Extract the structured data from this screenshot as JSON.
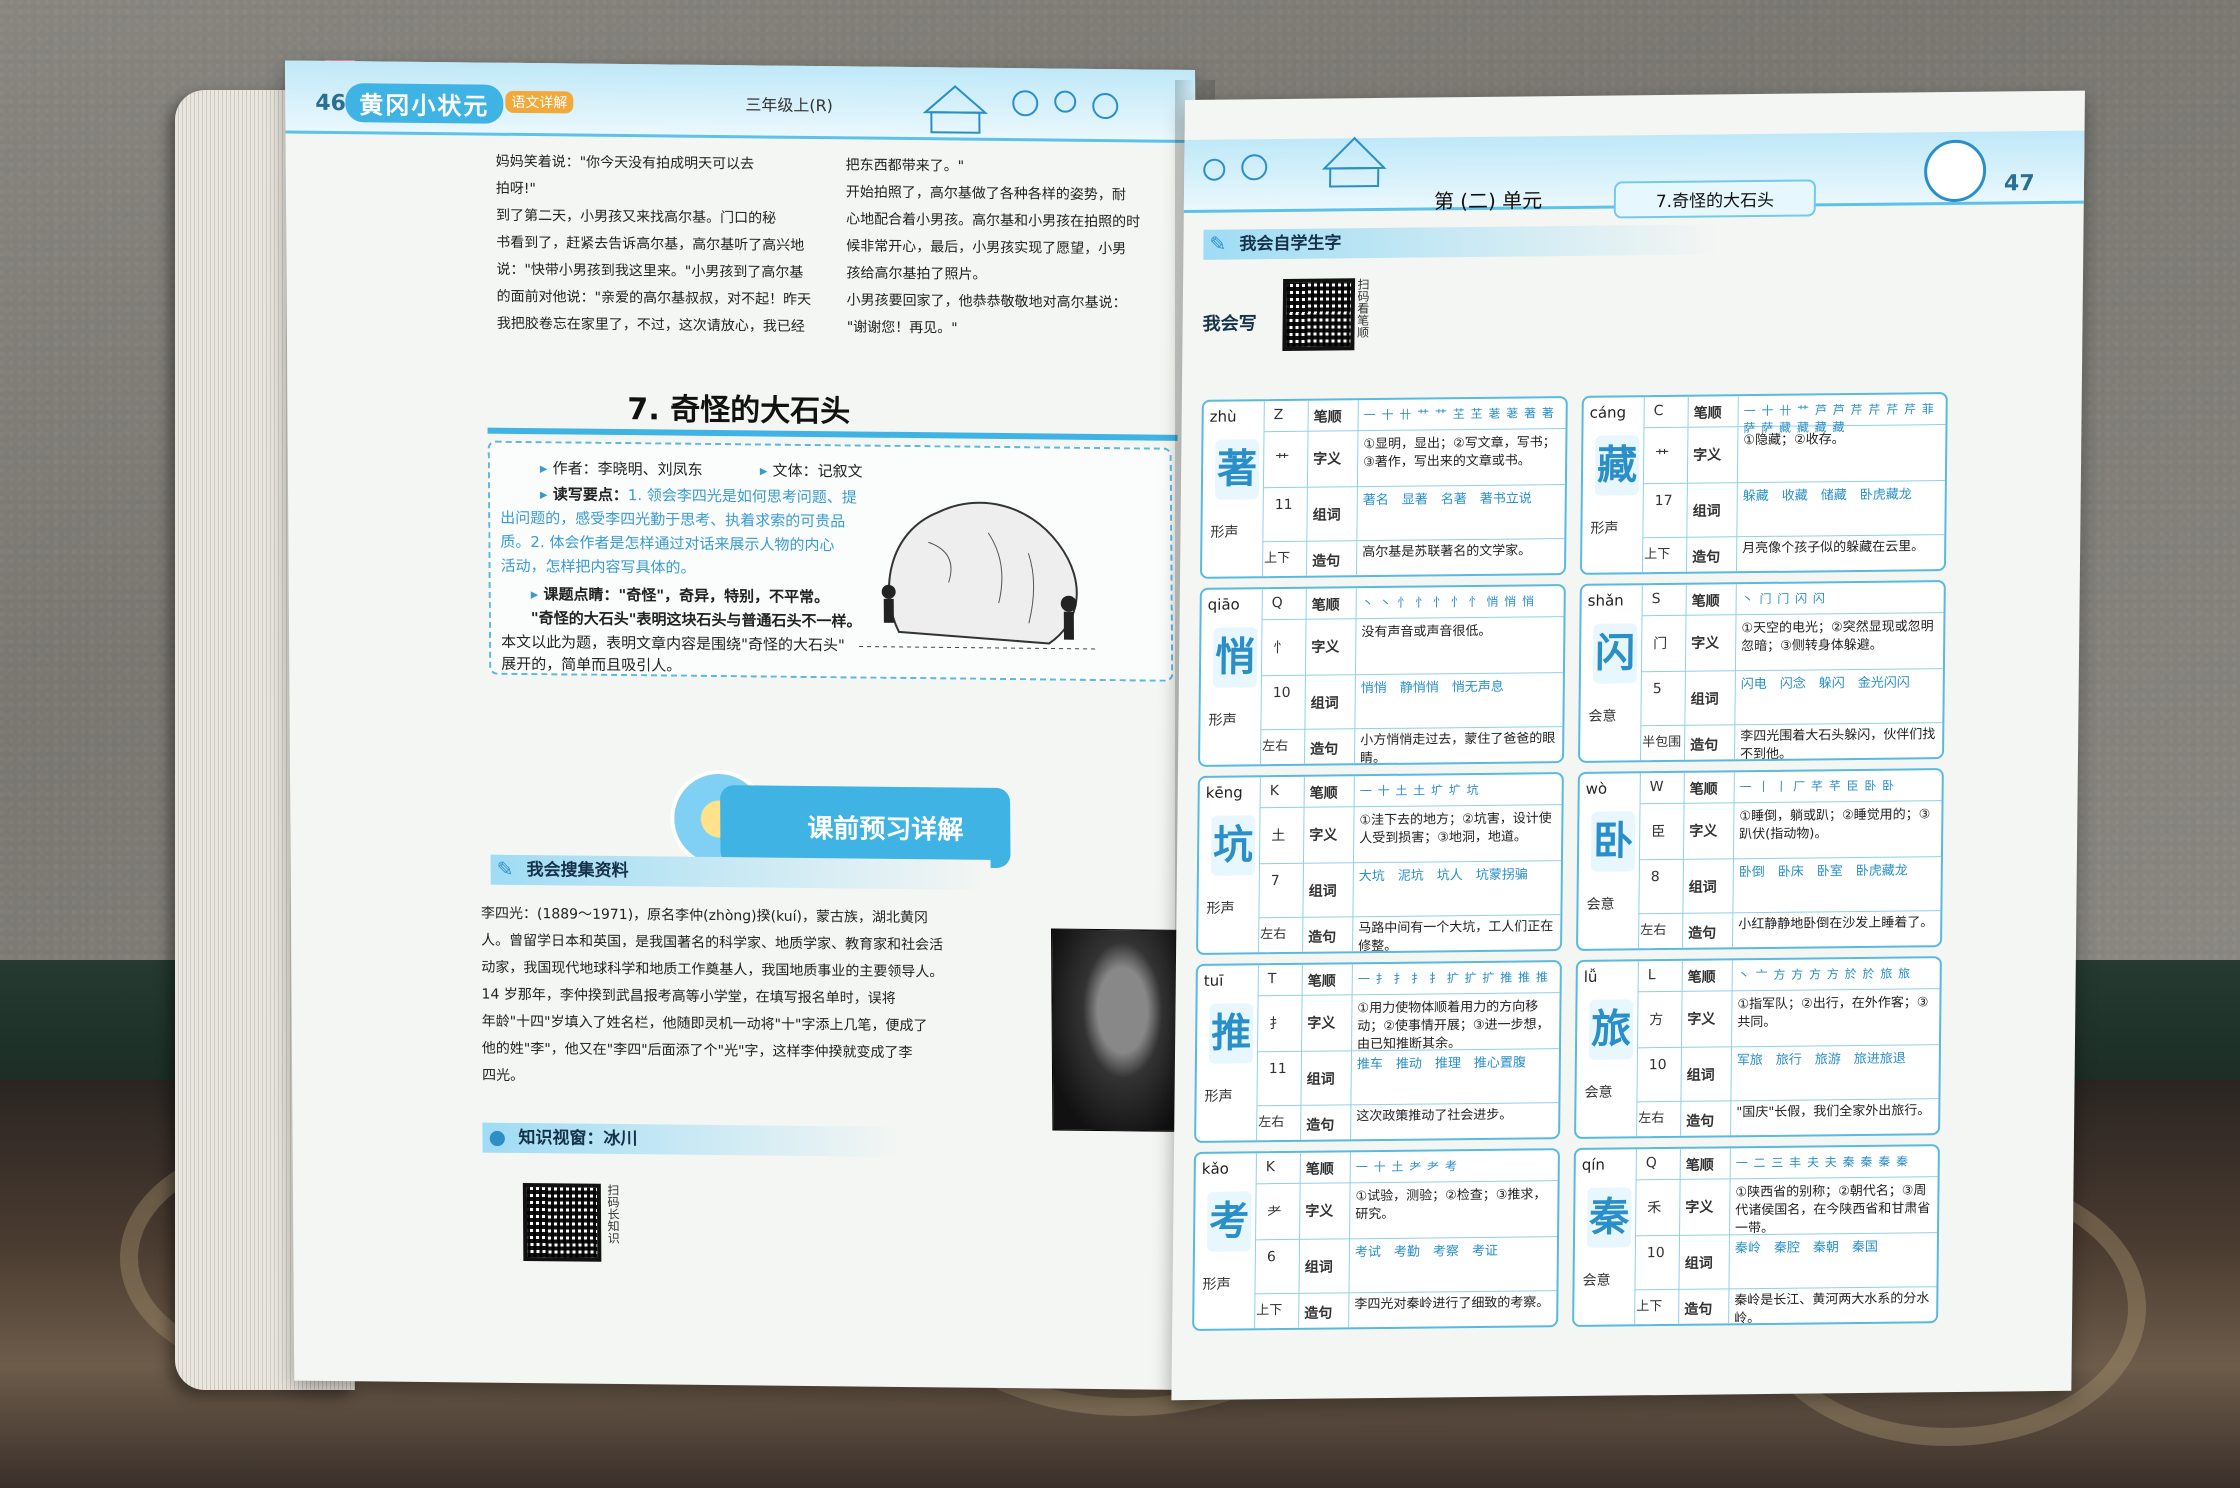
{
  "left_page": {
    "page_number": "46",
    "brand": "黄冈小状元",
    "brand_sub": "语文详解",
    "grade": "三年级上(R)",
    "story_col1": [
      "妈妈笑着说：\"你今天没有拍成明天可以去",
      "拍呀!\"",
      "到了第二天，小男孩又来找高尔基。门口的秘",
      "书看到了，赶紧去告诉高尔基，高尔基听了高兴地",
      "说：\"快带小男孩到我这里来。\"小男孩到了高尔基",
      "的面前对他说：\"亲爱的高尔基叔叔，对不起！昨天",
      "我把胶卷忘在家里了，不过，这次请放心，我已经"
    ],
    "story_col2": [
      "把东西都带来了。\"",
      "开始拍照了，高尔基做了各种各样的姿势，耐",
      "心地配合着小男孩。高尔基和小男孩在拍照的时",
      "候非常开心，最后，小男孩实现了愿望，小男",
      "孩给高尔基拍了照片。",
      "小男孩要回家了，他恭恭敬敬地对高尔基说：",
      "\"谢谢您！再见。\""
    ],
    "lesson_title": "7. 奇怪的大石头",
    "info": {
      "author": "作者：李晓明、刘凤东",
      "genre": "文体：记叙文",
      "key_label": "读写要点：",
      "key_lines": [
        "1. 领会李四光是如何思考问题、提",
        "出问题的，感受李四光勤于思考、执着求索的可贵品",
        "质。2. 体会作者是怎样通过对话来展示人物的内心",
        "活动，怎样把内容写具体的。"
      ],
      "topic_lines": [
        "课题点睛：\"奇怪\"，奇异，特别，不平常。",
        "\"奇怪的大石头\"表明这块石头与普通石头不一样。",
        "本文以此为题，表明文章内容是围绕\"奇怪的大石头\"",
        "展开的，简单而且吸引人。"
      ]
    },
    "preview_badge": "课前预习详解",
    "collect_head": "我会搜集资料",
    "bio_lines": [
      "李四光：(1889～1971)，原名李仲(zhòng)揆(kuí)，蒙古族，湖北黄冈",
      "人。曾留学日本和英国，是我国著名的科学家、地质学家、教育家和社会活",
      "动家，我国现代地球科学和地质工作奠基人，我国地质事业的主要领导人。",
      "14 岁那年，李仲揆到武昌报考高等小学堂，在填写报名单时，误将",
      "年龄\"十四\"岁填入了姓名栏，他随即灵机一动将\"十\"字添上几笔，便成了",
      "他的姓\"李\"，他又在\"李四\"后面添了个\"光\"字，这样李仲揆就变成了李",
      "四光。"
    ],
    "knowledge_head": "知识视窗：冰川",
    "qr_label": "扫码长知识"
  },
  "right_page": {
    "page_number": "47",
    "unit": "第 (二) 单元",
    "lesson_tag": "7.奇怪的大石头",
    "self_study_head": "我会自学生字",
    "write_label": "我会写",
    "qr_label": "扫码看笔顺",
    "labels": {
      "strokes": "笔顺",
      "meaning": "字义",
      "words": "组词",
      "sentence": "造句",
      "struct_pos_ud": "上下",
      "struct_pos_lr": "左右",
      "struct_pos_half": "半包围"
    },
    "cards": [
      {
        "pinyin": "zhù",
        "letter": "Z",
        "char": "著",
        "radical": "艹",
        "count": "11",
        "type": "形声",
        "pos": "上下",
        "strokes": "一 十 卄 艹 艹 芏 芏 荖 荖 著 著",
        "meaning": "①显明，显出；②写文章，写书；③著作，写出来的文章或书。",
        "words": "著名　显著　名著　著书立说",
        "sentence": "高尔基是苏联著名的文学家。"
      },
      {
        "pinyin": "cáng",
        "letter": "C",
        "char": "藏",
        "radical": "艹",
        "count": "17",
        "type": "形声",
        "pos": "上下",
        "strokes": "一 十 卄 艹 芦 芦 芹 芹 芹 芹 菲 萨 萨 藏 藏 藏 藏",
        "meaning": "①隐藏；②收存。",
        "words": "躲藏　收藏　储藏　卧虎藏龙",
        "sentence": "月亮像个孩子似的躲藏在云里。"
      },
      {
        "pinyin": "qiāo",
        "letter": "Q",
        "char": "悄",
        "radical": "忄",
        "count": "10",
        "type": "形声",
        "pos": "左右",
        "strokes": "丶 丶 忄 忄 忄 忄 忄 悄 悄 悄",
        "meaning": "没有声音或声音很低。",
        "words": "悄悄　静悄悄　悄无声息",
        "sentence": "小方悄悄走过去，蒙住了爸爸的眼睛。"
      },
      {
        "pinyin": "shǎn",
        "letter": "S",
        "char": "闪",
        "radical": "门",
        "count": "5",
        "type": "会意",
        "pos": "半包围",
        "strokes": "丶 门 门 闪 闪",
        "meaning": "①天空的电光；②突然显现或忽明忽暗；③侧转身体躲避。",
        "words": "闪电　闪念　躲闪　金光闪闪",
        "sentence": "李四光围着大石头躲闪，伙伴们找不到他。"
      },
      {
        "pinyin": "kēng",
        "letter": "K",
        "char": "坑",
        "radical": "土",
        "count": "7",
        "type": "形声",
        "pos": "左右",
        "strokes": "一 十 土 土 圹 圹 坑",
        "meaning": "①洼下去的地方；②坑害，设计使人受到损害；③地洞，地道。",
        "words": "大坑　泥坑　坑人　坑蒙拐骗",
        "sentence": "马路中间有一个大坑，工人们正在修整。"
      },
      {
        "pinyin": "wò",
        "letter": "W",
        "char": "卧",
        "radical": "臣",
        "count": "8",
        "type": "会意",
        "pos": "左右",
        "strokes": "一 丨 丨 厂 芊 芊 臣 卧 卧",
        "meaning": "①睡倒，躺或趴；②睡觉用的；③趴伏(指动物)。",
        "words": "卧倒　卧床　卧室　卧虎藏龙",
        "sentence": "小红静静地卧倒在沙发上睡着了。"
      },
      {
        "pinyin": "tuī",
        "letter": "T",
        "char": "推",
        "radical": "扌",
        "count": "11",
        "type": "形声",
        "pos": "左右",
        "strokes": "一 扌 扌 扌 扌 扩 扩 扩 推 推 推",
        "meaning": "①用力使物体顺着用力的方向移动；②使事情开展；③进一步想，由已知推断其余。",
        "words": "推车　推动　推理　推心置腹",
        "sentence": "这次政策推动了社会进步。"
      },
      {
        "pinyin": "lǚ",
        "letter": "L",
        "char": "旅",
        "radical": "方",
        "count": "10",
        "type": "会意",
        "pos": "左右",
        "strokes": "丶 亠 方 方 方 方 於 於 旅 旅",
        "meaning": "①指军队；②出行，在外作客；③共同。",
        "words": "军旅　旅行　旅游　旅进旅退",
        "sentence": "\"国庆\"长假，我们全家外出旅行。"
      },
      {
        "pinyin": "kǎo",
        "letter": "K",
        "char": "考",
        "radical": "耂",
        "count": "6",
        "type": "形声",
        "pos": "上下",
        "strokes": "一 十 土 耂 耂 考",
        "meaning": "①试验，测验；②检查；③推求，研究。",
        "words": "考试　考勤　考察　考证",
        "sentence": "李四光对秦岭进行了细致的考察。"
      },
      {
        "pinyin": "qín",
        "letter": "Q",
        "char": "秦",
        "radical": "禾",
        "count": "10",
        "type": "会意",
        "pos": "上下",
        "strokes": "一 二 三 丰 夫 夫 秦 秦 秦 秦",
        "meaning": "①陕西省的别称；②朝代名；③周代诸侯国名，在今陕西省和甘肃省一带。",
        "words": "秦岭　秦腔　秦朝　秦国",
        "sentence": "秦岭是长江、黄河两大水系的分水岭。"
      }
    ]
  }
}
